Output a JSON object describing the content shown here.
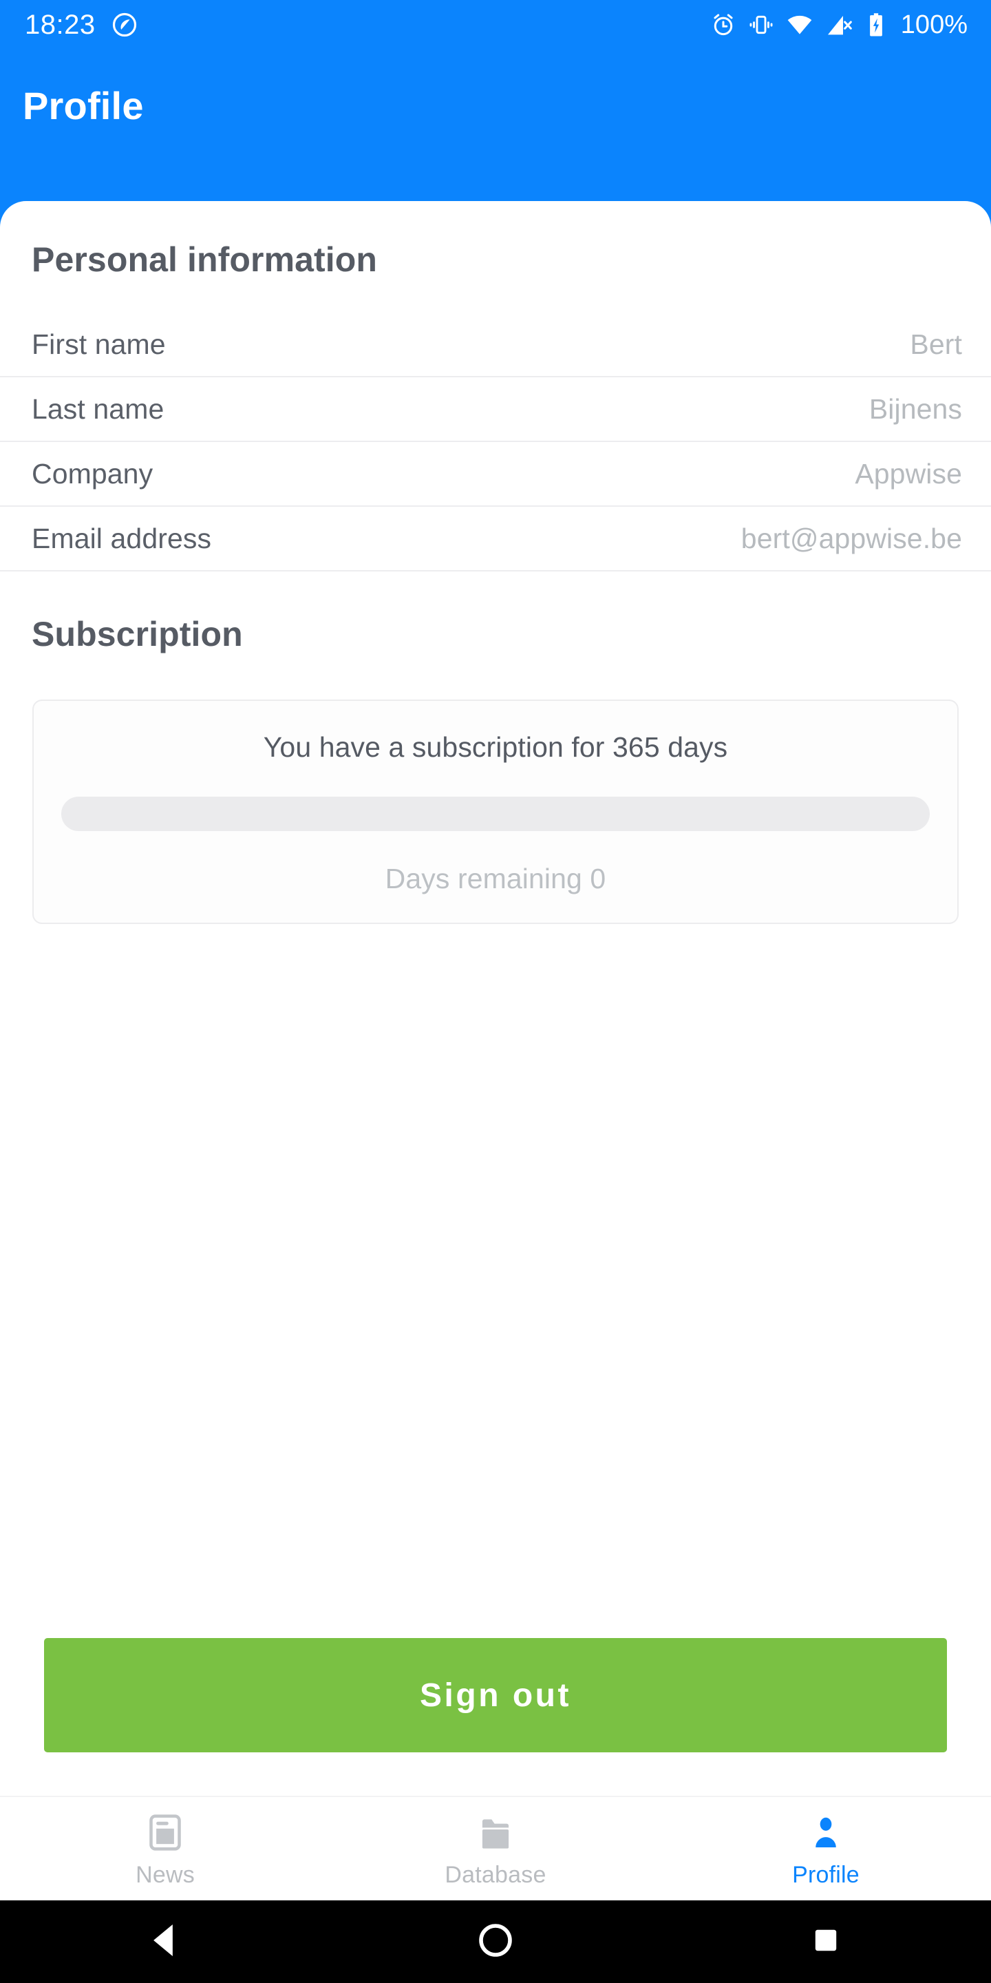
{
  "status_bar": {
    "time": "18:23",
    "battery_percent": "100%",
    "icons": [
      "location-circle-icon",
      "alarm-icon",
      "vibrate-icon",
      "wifi-icon",
      "signal-off-icon",
      "battery-charging-icon"
    ],
    "background_color": "#0b84fd",
    "foreground_color": "#ffffff"
  },
  "app_bar": {
    "title": "Profile",
    "background_color": "#0b84fd"
  },
  "personal_information": {
    "heading": "Personal information",
    "rows": [
      {
        "label": "First name",
        "value": "Bert"
      },
      {
        "label": "Last name",
        "value": "Bijnens"
      },
      {
        "label": "Company",
        "value": "Appwise"
      },
      {
        "label": "Email address",
        "value": "bert@appwise.be"
      }
    ]
  },
  "subscription": {
    "heading": "Subscription",
    "headline": "You have a subscription for 365 days",
    "total_days": 365,
    "days_remaining_label": "Days remaining 0",
    "days_remaining": 0,
    "progress_percent": 0,
    "track_color": "#ebebed",
    "fill_color": "#7ac143"
  },
  "actions": {
    "sign_out_label": "Sign out",
    "sign_out_color": "#7ac143"
  },
  "bottom_nav": {
    "active_color": "#0b84fd",
    "inactive_color": "#b9bcc0",
    "items": [
      {
        "label": "News",
        "icon": "news-icon",
        "active": false
      },
      {
        "label": "Database",
        "icon": "folder-icon",
        "active": false
      },
      {
        "label": "Profile",
        "icon": "person-icon",
        "active": true
      }
    ]
  },
  "android_nav": {
    "back": "back-triangle-icon",
    "home": "home-circle-icon",
    "recents": "recents-square-icon"
  }
}
